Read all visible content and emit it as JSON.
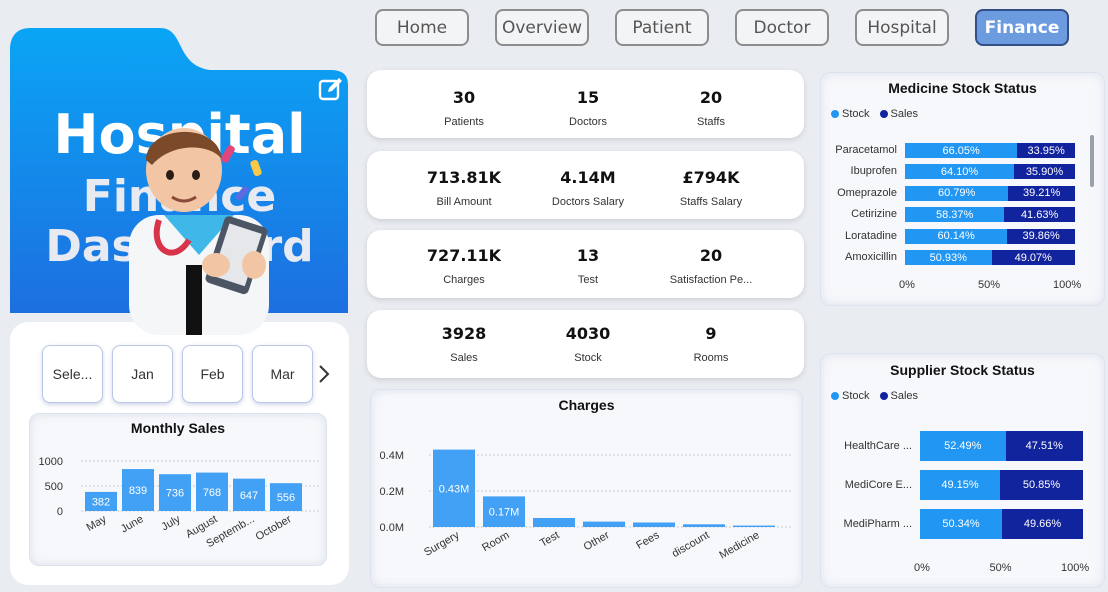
{
  "nav": [
    "Home",
    "Overview",
    "Patient",
    "Doctor",
    "Hospital",
    "Finance"
  ],
  "nav_active": "Finance",
  "hero": {
    "line1": "Hospital",
    "line2": "Finance",
    "line3": "Dashboard"
  },
  "months": [
    "Sele...",
    "Jan",
    "Feb",
    "Mar"
  ],
  "kpis": [
    [
      {
        "value": "30",
        "label": "Patients"
      },
      {
        "value": "15",
        "label": "Doctors"
      },
      {
        "value": "20",
        "label": "Staffs"
      }
    ],
    [
      {
        "value": "713.81K",
        "label": "Bill Amount"
      },
      {
        "value": "4.14M",
        "label": "Doctors Salary"
      },
      {
        "value": "£794K",
        "label": "Staffs Salary"
      }
    ],
    [
      {
        "value": "727.11K",
        "label": "Charges"
      },
      {
        "value": "13",
        "label": "Test"
      },
      {
        "value": "20",
        "label": "Satisfaction Pe..."
      }
    ],
    [
      {
        "value": "3928",
        "label": "Sales"
      },
      {
        "value": "4030",
        "label": "Stock"
      },
      {
        "value": "9",
        "label": "Rooms"
      }
    ]
  ],
  "colors": {
    "stock": "#2196f3",
    "sales": "#12239e",
    "bar": "#42a0f5"
  },
  "chart_data": [
    {
      "type": "bar",
      "title": "Monthly Sales",
      "categories": [
        "May",
        "June",
        "July",
        "August",
        "Septemb...",
        "October"
      ],
      "values": [
        382,
        839,
        736,
        768,
        647,
        556
      ],
      "yticks": [
        "1000",
        "500",
        "0"
      ],
      "ylim": [
        0,
        1000
      ]
    },
    {
      "type": "bar",
      "title": "Charges",
      "categories": [
        "Surgery",
        "Room",
        "Test",
        "Other",
        "Fees",
        "discount",
        "Medicine"
      ],
      "values": [
        0.43,
        0.17,
        0.05,
        0.03,
        0.025,
        0.015,
        0.008
      ],
      "data_labels": [
        "0.43M",
        "0.17M",
        "",
        "",
        "",
        "",
        ""
      ],
      "yticks": [
        "0.4M",
        "0.2M",
        "0.0M"
      ],
      "ylim": [
        0,
        0.45
      ]
    },
    {
      "type": "bar",
      "orientation": "horizontal-stacked",
      "title": "Medicine Stock Status",
      "legend": [
        "Stock",
        "Sales"
      ],
      "categories": [
        "Paracetamol",
        "Ibuprofen",
        "Omeprazole",
        "Cetirizine",
        "Loratadine",
        "Amoxicillin"
      ],
      "series": [
        {
          "name": "Stock",
          "values": [
            66.05,
            64.1,
            60.79,
            58.37,
            60.14,
            50.93
          ],
          "labels": [
            "66.05%",
            "64.10%",
            "60.79%",
            "58.37%",
            "60.14%",
            "50.93%"
          ]
        },
        {
          "name": "Sales",
          "values": [
            33.95,
            35.9,
            39.21,
            41.63,
            39.86,
            49.07
          ],
          "labels": [
            "33.95%",
            "35.90%",
            "39.21%",
            "41.63%",
            "39.86%",
            "49.07%"
          ]
        }
      ],
      "xticks": [
        "0%",
        "50%",
        "100%"
      ]
    },
    {
      "type": "bar",
      "orientation": "horizontal-stacked",
      "title": "Supplier Stock Status",
      "legend": [
        "Stock",
        "Sales"
      ],
      "categories": [
        "HealthCare ...",
        "MediCore E...",
        "MediPharm ..."
      ],
      "series": [
        {
          "name": "Stock",
          "values": [
            52.49,
            49.15,
            50.34
          ],
          "labels": [
            "52.49%",
            "49.15%",
            "50.34%"
          ]
        },
        {
          "name": "Sales",
          "values": [
            47.51,
            50.85,
            49.66
          ],
          "labels": [
            "47.51%",
            "50.85%",
            "49.66%"
          ]
        }
      ],
      "xticks": [
        "0%",
        "50%",
        "100%"
      ]
    }
  ]
}
